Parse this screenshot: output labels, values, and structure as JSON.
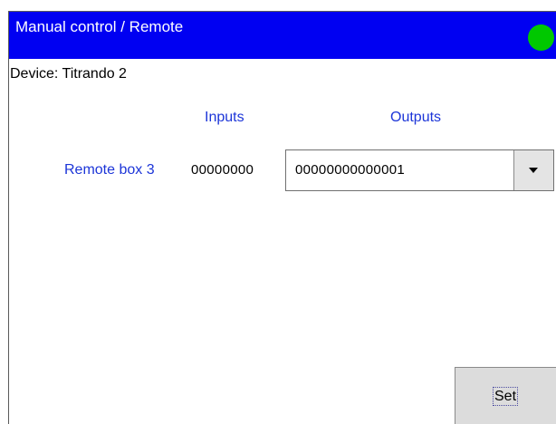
{
  "window": {
    "title": "Manual control / Remote",
    "status_color": "#00c800",
    "title_bar_color": "#0000f2"
  },
  "device": {
    "label": "Device: Titrando 2"
  },
  "columns": {
    "inputs": "Inputs",
    "outputs": "Outputs"
  },
  "row": {
    "label": "Remote box 3",
    "inputs_value": "00000000",
    "outputs_value": "00000000000001"
  },
  "actions": {
    "set_label": "Set"
  }
}
